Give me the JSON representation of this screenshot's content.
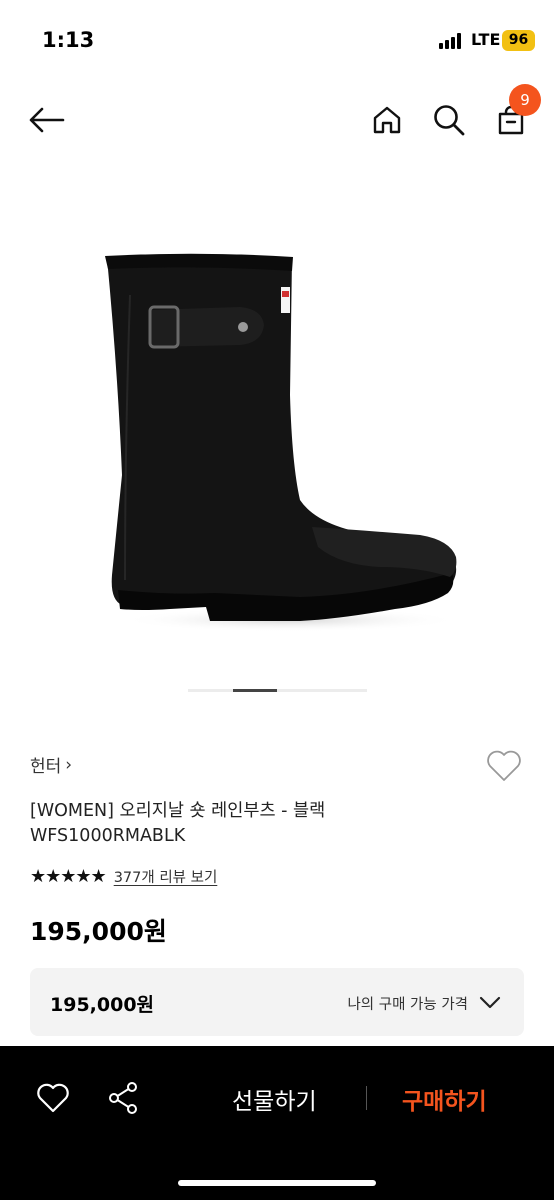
{
  "status_bar": {
    "time": "1:13",
    "network": "LTE",
    "battery": "96"
  },
  "header": {
    "back_icon": "arrow-left-icon",
    "home_icon": "home-icon",
    "search_icon": "search-icon",
    "cart_icon": "shopping-bag-icon",
    "cart_count": "9"
  },
  "product": {
    "brand": "헌터",
    "brand_chevron": "›",
    "title_line1": "[WOMEN] 오리지날 숏 레인부츠 - 블랙",
    "title_line2": "WFS1000RMABLK",
    "rating_stars": "★★★★★",
    "rating_value": 5,
    "review_link": "377개 리뷰 보기",
    "price": "195,000원"
  },
  "image_carousel": {
    "current_index": 2,
    "total": 4
  },
  "my_price_box": {
    "price": "195,000원",
    "label": "나의 구매 가능 가격"
  },
  "bottom_bar": {
    "gift_label": "선물하기",
    "buy_label": "구매하기"
  },
  "colors": {
    "accent": "#f4541e",
    "bottom_bar_bg": "#000000",
    "price_box_bg": "#f3f3f3",
    "battery": "#f2c012"
  }
}
